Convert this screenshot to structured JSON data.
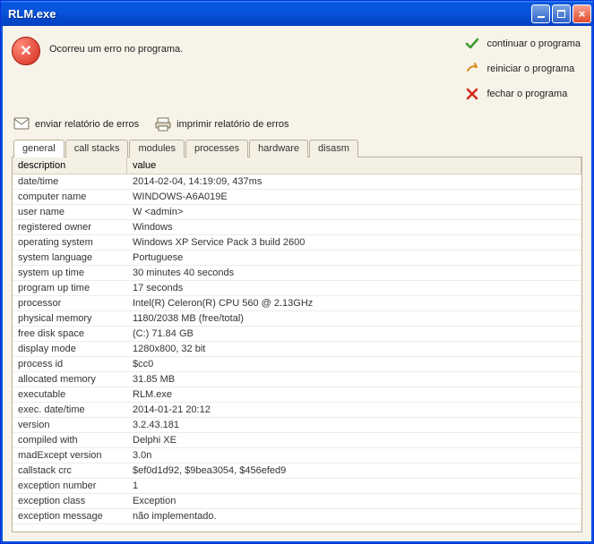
{
  "window": {
    "title": "RLM.exe"
  },
  "error": {
    "message": "Ocorreu um erro no programa."
  },
  "actions": {
    "continue": "continuar o programa",
    "restart": "reiniciar o programa",
    "close": "fechar o programa"
  },
  "toolbar": {
    "send_report": "enviar relatório de erros",
    "print_report": "imprimir relatório de erros"
  },
  "tabs": {
    "general": "general",
    "callstacks": "call stacks",
    "modules": "modules",
    "processes": "processes",
    "hardware": "hardware",
    "disasm": "disasm"
  },
  "grid": {
    "headers": {
      "description": "description",
      "value": "value"
    },
    "rows": [
      {
        "desc": "date/time",
        "val": "2014-02-04, 14:19:09, 437ms"
      },
      {
        "desc": "computer name",
        "val": "WINDOWS-A6A019E"
      },
      {
        "desc": "user name",
        "val": "W  <admin>"
      },
      {
        "desc": "registered owner",
        "val": "Windows"
      },
      {
        "desc": "operating system",
        "val": "Windows XP Service Pack 3 build 2600"
      },
      {
        "desc": "system language",
        "val": "Portuguese"
      },
      {
        "desc": "system up time",
        "val": "30 minutes 40 seconds"
      },
      {
        "desc": "program up time",
        "val": "17 seconds"
      },
      {
        "desc": "processor",
        "val": "Intel(R) Celeron(R) CPU 560 @ 2.13GHz"
      },
      {
        "desc": "physical memory",
        "val": "1180/2038 MB (free/total)"
      },
      {
        "desc": "free disk space",
        "val": "(C:) 71.84 GB"
      },
      {
        "desc": "display mode",
        "val": "1280x800, 32 bit"
      },
      {
        "desc": "process id",
        "val": "$cc0"
      },
      {
        "desc": "allocated memory",
        "val": "31.85 MB"
      },
      {
        "desc": "executable",
        "val": "RLM.exe"
      },
      {
        "desc": "exec. date/time",
        "val": "2014-01-21 20:12"
      },
      {
        "desc": "version",
        "val": "3.2.43.181"
      },
      {
        "desc": "compiled with",
        "val": "Delphi XE"
      },
      {
        "desc": "madExcept version",
        "val": "3.0n"
      },
      {
        "desc": "callstack crc",
        "val": "$ef0d1d92, $9bea3054, $456efed9"
      },
      {
        "desc": "exception number",
        "val": "1"
      },
      {
        "desc": "exception class",
        "val": "Exception"
      },
      {
        "desc": "exception message",
        "val": "não implementado."
      }
    ]
  }
}
